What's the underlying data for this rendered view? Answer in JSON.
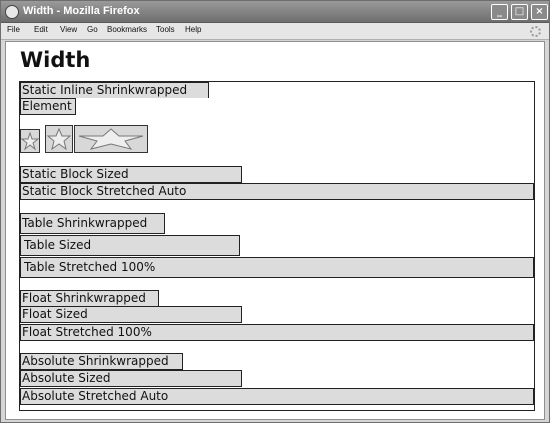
{
  "window": {
    "title": "Width - Mozilla Firefox",
    "controls": [
      "_",
      "□",
      "×"
    ]
  },
  "menubar": {
    "items": [
      "File",
      "Edit",
      "View",
      "Go",
      "Bookmarks",
      "Tools",
      "Help"
    ]
  },
  "page": {
    "title": "Width",
    "static_inline_line1": "Static Inline Shrinkwrapped",
    "static_inline_line2": "Element",
    "static_block_sized": "Static Block Sized",
    "static_block_stretched": "Static Block Stretched Auto",
    "table_shrinkwrapped": "Table Shrinkwrapped",
    "table_sized": "Table Sized",
    "table_stretched": "Table Stretched 100%",
    "float_shrinkwrapped": "Float Shrinkwrapped",
    "float_sized": "Float Sized",
    "float_stretched": "Float Stretched 100%",
    "absolute_shrinkwrapped": "Absolute Shrinkwrapped",
    "absolute_sized": "Absolute Sized",
    "absolute_stretched": "Absolute Stretched Auto"
  }
}
